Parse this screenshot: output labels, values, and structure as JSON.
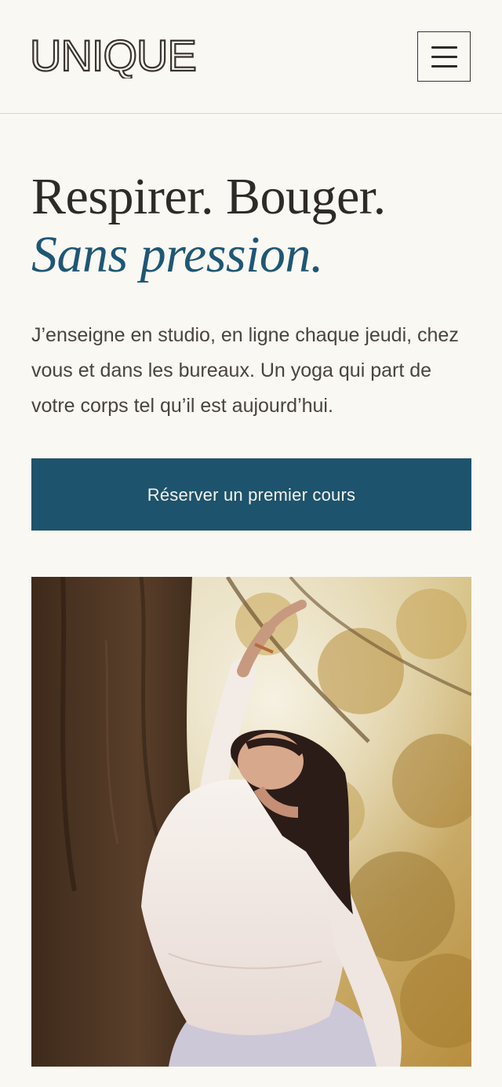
{
  "header": {
    "logo_text": "UNIQUE",
    "menu_icon": "hamburger-menu-icon"
  },
  "hero": {
    "title_line1": "Respirer. Bouger.",
    "title_line2": "Sans pression.",
    "intro": "J’enseigne en studio, en ligne chaque jeudi, chez vous et dans les bureaux. Un yoga qui part de votre corps tel qu’il est aujourd’hui.",
    "cta_label": "Réserver un premier cours"
  },
  "colors": {
    "background": "#faf8f3",
    "accent_blue": "#1e5775",
    "button": "#1d536c",
    "text": "#2e2a26"
  }
}
